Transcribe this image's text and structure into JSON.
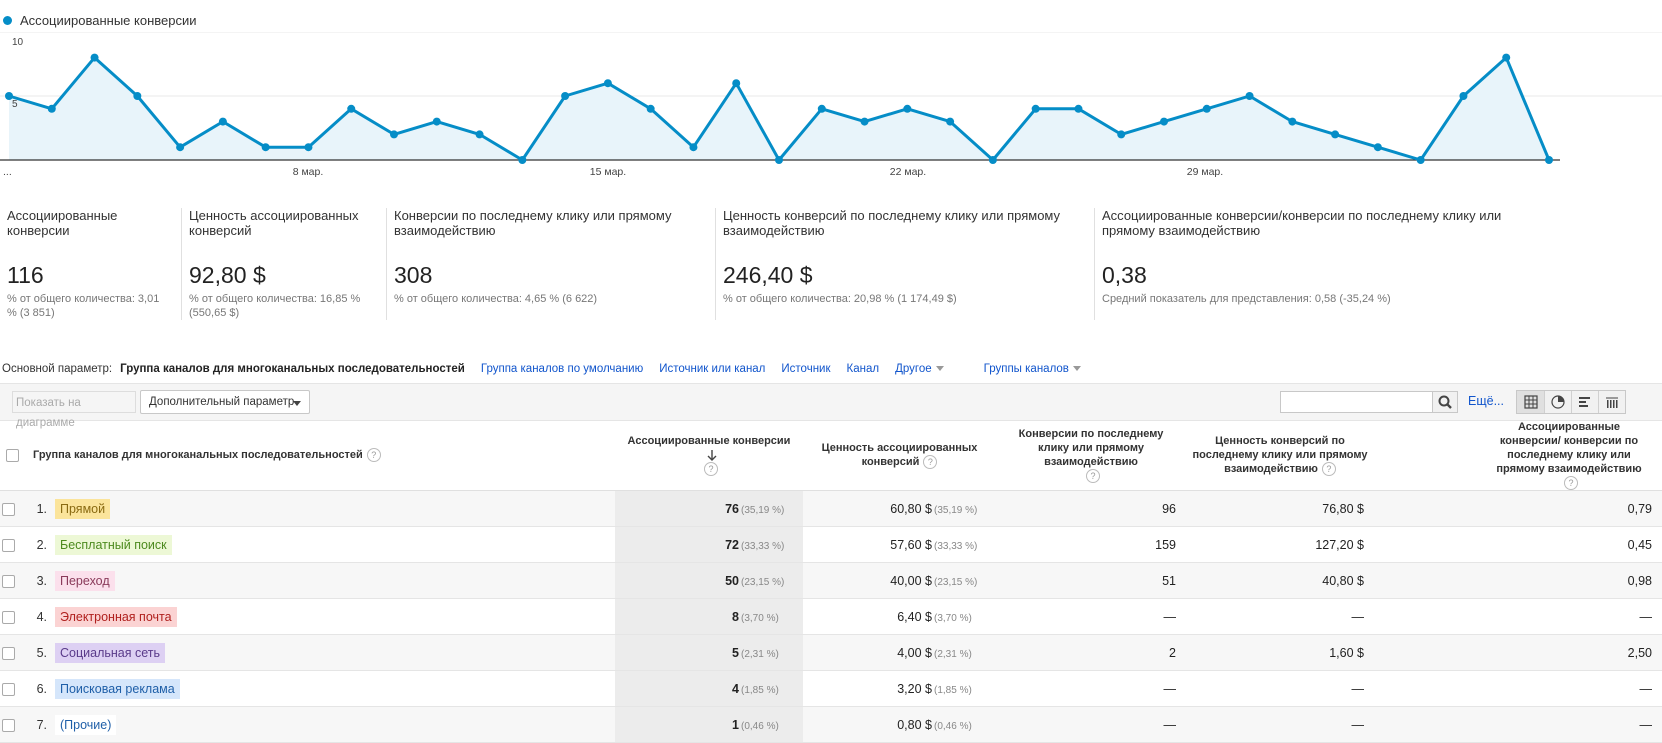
{
  "chart": {
    "legend": "Ассоциированные конверсии",
    "color": "#058dc7",
    "y_ticks": [
      "10",
      "5"
    ],
    "x_labels": [
      "...",
      "8 мар.",
      "15 мар.",
      "22 мар.",
      "29 мар."
    ]
  },
  "chart_data": {
    "type": "area",
    "series": [
      {
        "name": "Ассоциированные конверсии",
        "values": [
          5,
          4,
          8,
          5,
          1,
          3,
          1,
          1,
          4,
          2,
          3,
          2,
          0,
          5,
          6,
          4,
          1,
          6,
          0,
          4,
          3,
          4,
          3,
          0,
          4,
          4,
          2,
          3,
          4,
          5,
          3,
          2,
          1,
          0,
          5,
          8,
          0
        ]
      }
    ],
    "ylim": [
      0,
      10
    ],
    "grid": true
  },
  "metrics": [
    {
      "label": "Ассоциированные конверсии",
      "value": "116",
      "sub": "% от общего количества: 3,01 % (3 851)"
    },
    {
      "label": "Ценность ассоциированных конверсий",
      "value": "92,80 $",
      "sub": "% от общего количества: 16,85 % (550,65 $)"
    },
    {
      "label": "Конверсии по последнему клику или прямому взаимодействию",
      "value": "308",
      "sub": "% от общего количества: 4,65 % (6 622)"
    },
    {
      "label": "Ценность конверсий по последнему клику или прямому взаимодействию",
      "value": "246,40 $",
      "sub": "% от общего количества: 20,98 % (1 174,49 $)"
    },
    {
      "label": "Ассоциированные конверсии/конверсии по последнему клику или прямому взаимодействию",
      "value": "0,38",
      "sub": "Средний показатель для представления: 0,58 (-35,24 %)"
    }
  ],
  "dimbar": {
    "label": "Основной параметр:",
    "current": "Группа каналов для многоканальных последовательностей",
    "links": [
      "Группа каналов по умолчанию",
      "Источник или канал",
      "Источник",
      "Канал"
    ],
    "other": "Другое",
    "groups": "Группы каналов"
  },
  "toolbar": {
    "plot_button": "Показать на диаграмме",
    "secondary_param": "Дополнительный параметр",
    "search_value": "",
    "more": "Ещё..."
  },
  "table": {
    "headers": {
      "dim": "Группа каналов для многоканальных последовательностей",
      "c1": "Ассоциированные конверсии",
      "c2": "Ценность ассоциированных конверсий",
      "c3": "Конверсии по последнему клику или прямому взаимодействию",
      "c4": "Ценность конверсий по последнему клику или прямому взаимодействию",
      "c5": "Ассоциированные конверсии/ конверсии по последнему клику или прямому взаимодействию"
    },
    "rows": [
      {
        "idx": "1.",
        "name": "Прямой",
        "bg": "#fbe49b",
        "fg": "#8a6a12",
        "ac": "76",
        "ac_pct": "(35,19 %)",
        "val": "60,80 $",
        "val_pct": "(35,19 %)",
        "last": "96",
        "last_val": "76,80 $",
        "ratio": "0,79"
      },
      {
        "idx": "2.",
        "name": "Бесплатный поиск",
        "bg": "#edf8d6",
        "fg": "#4c8a1e",
        "ac": "72",
        "ac_pct": "(33,33 %)",
        "val": "57,60 $",
        "val_pct": "(33,33 %)",
        "last": "159",
        "last_val": "127,20 $",
        "ratio": "0,45"
      },
      {
        "idx": "3.",
        "name": "Переход",
        "bg": "#fbe0ec",
        "fg": "#8a3a5a",
        "ac": "50",
        "ac_pct": "(23,15 %)",
        "val": "40,00 $",
        "val_pct": "(23,15 %)",
        "last": "51",
        "last_val": "40,80 $",
        "ratio": "0,98"
      },
      {
        "idx": "4.",
        "name": "Электронная почта",
        "bg": "#fbd3d3",
        "fg": "#b0201e",
        "ac": "8",
        "ac_pct": "(3,70 %)",
        "val": "6,40 $",
        "val_pct": "(3,70 %)",
        "last": "—",
        "last_val": "—",
        "ratio": "—"
      },
      {
        "idx": "5.",
        "name": "Социальная сеть",
        "bg": "#ddd0f3",
        "fg": "#5a3a8a",
        "ac": "5",
        "ac_pct": "(2,31 %)",
        "val": "4,00 $",
        "val_pct": "(2,31 %)",
        "last": "2",
        "last_val": "1,60 $",
        "ratio": "2,50"
      },
      {
        "idx": "6.",
        "name": "Поисковая реклама",
        "bg": "#d5e6fb",
        "fg": "#1f5fa8",
        "ac": "4",
        "ac_pct": "(1,85 %)",
        "val": "3,20 $",
        "val_pct": "(1,85 %)",
        "last": "—",
        "last_val": "—",
        "ratio": "—"
      },
      {
        "idx": "7.",
        "name": "(Прочие)",
        "bg": "#ffffff",
        "fg": "#1f5fa8",
        "ac": "1",
        "ac_pct": "(0,46 %)",
        "val": "0,80 $",
        "val_pct": "(0,46 %)",
        "last": "—",
        "last_val": "—",
        "ratio": "—"
      }
    ]
  },
  "icons": {
    "search": "search-icon",
    "views": [
      "table-view-icon",
      "pie-view-icon",
      "performance-view-icon",
      "comparison-view-icon"
    ]
  }
}
